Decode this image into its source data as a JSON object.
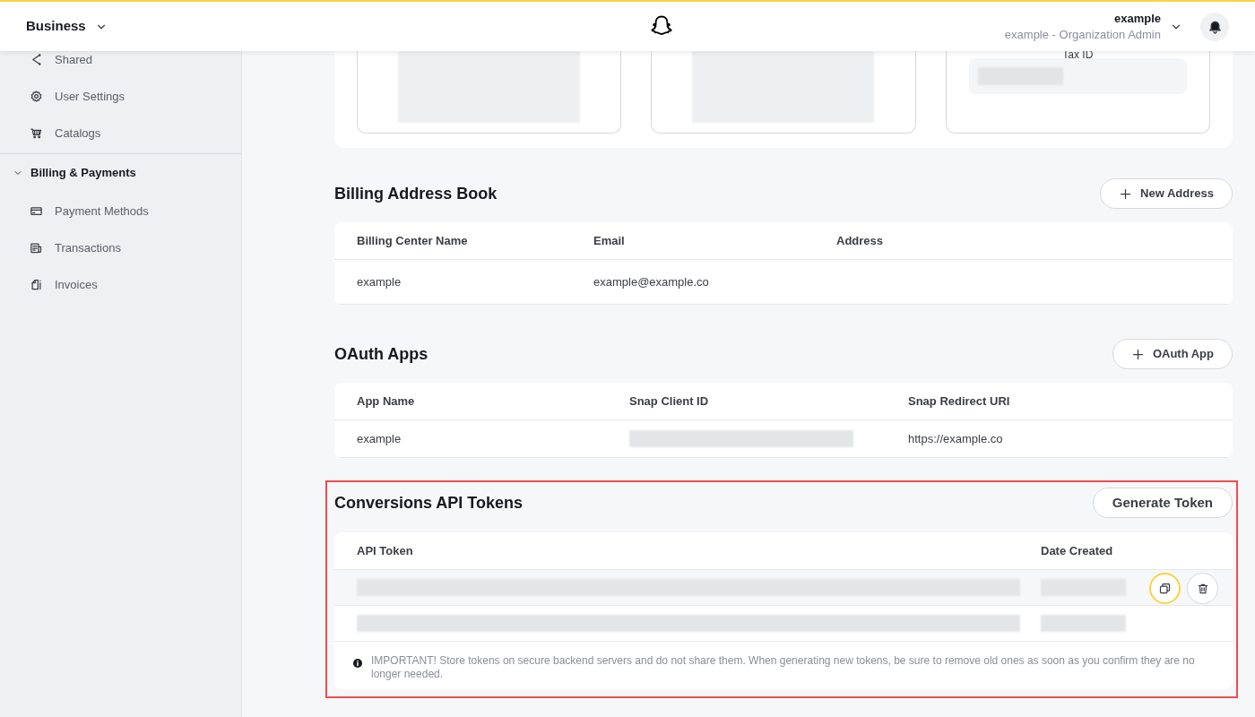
{
  "header": {
    "brand": "Business",
    "user_name": "example",
    "user_role": "example - Organization Admin"
  },
  "sidebar": {
    "items": [
      {
        "label": "Shared"
      },
      {
        "label": "User Settings"
      },
      {
        "label": "Catalogs"
      }
    ],
    "sections": [
      {
        "title": "Billing & Payments",
        "expanded": true,
        "items": [
          {
            "label": "Payment Methods"
          },
          {
            "label": "Transactions"
          },
          {
            "label": "Invoices"
          }
        ]
      }
    ]
  },
  "top_cards": [
    {
      "kind": "blurred"
    },
    {
      "kind": "blurred"
    },
    {
      "kind": "field",
      "label": "Tax ID"
    }
  ],
  "sections": [
    {
      "title": "Billing Address Book",
      "button": {
        "kind": "add",
        "label": "New Address"
      },
      "columns": [
        "Billing Center Name",
        "Email",
        "Address"
      ],
      "rows": [
        {
          "cells": [
            {
              "kind": "text",
              "text": "example"
            },
            {
              "kind": "text",
              "text": "example@example.co"
            }
          ]
        }
      ]
    },
    {
      "title": "OAuth Apps",
      "button": {
        "kind": "add",
        "label": "OAuth App"
      },
      "columns": [
        "App Name",
        "Snap Client ID",
        "Snap Redirect URI"
      ],
      "rows": [
        {
          "cells": [
            {
              "kind": "text",
              "text": "example"
            },
            {
              "kind": "blurred"
            },
            {
              "kind": "text",
              "text": "https://example.co"
            }
          ]
        }
      ]
    },
    {
      "title": "Conversions API Tokens",
      "button": {
        "kind": "plain",
        "label": "Generate Token"
      },
      "outlined": true,
      "columns": [
        "API Token",
        "Date Created"
      ],
      "rows": [
        {
          "highlighted": true,
          "cells": [
            {
              "kind": "blurred"
            },
            {
              "kind": "blurred"
            }
          ]
        },
        {
          "highlighted": false,
          "cells": [
            {
              "kind": "blurred"
            },
            {
              "kind": "blurred"
            }
          ]
        }
      ],
      "note": "IMPORTANT! Store tokens on secure backend servers and do not share them. When generating new tokens, be sure to remove old ones as soon as you confirm they are no longer needed."
    }
  ]
}
